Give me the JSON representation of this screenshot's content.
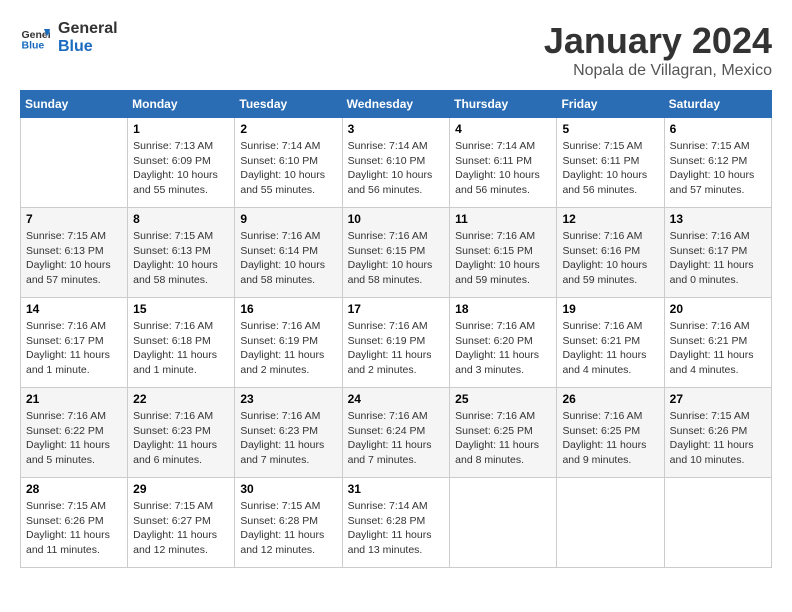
{
  "logo": {
    "line1": "General",
    "line2": "Blue"
  },
  "title": "January 2024",
  "subtitle": "Nopala de Villagran, Mexico",
  "headers": [
    "Sunday",
    "Monday",
    "Tuesday",
    "Wednesday",
    "Thursday",
    "Friday",
    "Saturday"
  ],
  "weeks": [
    [
      {
        "day": "",
        "info": ""
      },
      {
        "day": "1",
        "info": "Sunrise: 7:13 AM\nSunset: 6:09 PM\nDaylight: 10 hours\nand 55 minutes."
      },
      {
        "day": "2",
        "info": "Sunrise: 7:14 AM\nSunset: 6:10 PM\nDaylight: 10 hours\nand 55 minutes."
      },
      {
        "day": "3",
        "info": "Sunrise: 7:14 AM\nSunset: 6:10 PM\nDaylight: 10 hours\nand 56 minutes."
      },
      {
        "day": "4",
        "info": "Sunrise: 7:14 AM\nSunset: 6:11 PM\nDaylight: 10 hours\nand 56 minutes."
      },
      {
        "day": "5",
        "info": "Sunrise: 7:15 AM\nSunset: 6:11 PM\nDaylight: 10 hours\nand 56 minutes."
      },
      {
        "day": "6",
        "info": "Sunrise: 7:15 AM\nSunset: 6:12 PM\nDaylight: 10 hours\nand 57 minutes."
      }
    ],
    [
      {
        "day": "7",
        "info": "Sunrise: 7:15 AM\nSunset: 6:13 PM\nDaylight: 10 hours\nand 57 minutes."
      },
      {
        "day": "8",
        "info": "Sunrise: 7:15 AM\nSunset: 6:13 PM\nDaylight: 10 hours\nand 58 minutes."
      },
      {
        "day": "9",
        "info": "Sunrise: 7:16 AM\nSunset: 6:14 PM\nDaylight: 10 hours\nand 58 minutes."
      },
      {
        "day": "10",
        "info": "Sunrise: 7:16 AM\nSunset: 6:15 PM\nDaylight: 10 hours\nand 58 minutes."
      },
      {
        "day": "11",
        "info": "Sunrise: 7:16 AM\nSunset: 6:15 PM\nDaylight: 10 hours\nand 59 minutes."
      },
      {
        "day": "12",
        "info": "Sunrise: 7:16 AM\nSunset: 6:16 PM\nDaylight: 10 hours\nand 59 minutes."
      },
      {
        "day": "13",
        "info": "Sunrise: 7:16 AM\nSunset: 6:17 PM\nDaylight: 11 hours\nand 0 minutes."
      }
    ],
    [
      {
        "day": "14",
        "info": "Sunrise: 7:16 AM\nSunset: 6:17 PM\nDaylight: 11 hours\nand 1 minute."
      },
      {
        "day": "15",
        "info": "Sunrise: 7:16 AM\nSunset: 6:18 PM\nDaylight: 11 hours\nand 1 minute."
      },
      {
        "day": "16",
        "info": "Sunrise: 7:16 AM\nSunset: 6:19 PM\nDaylight: 11 hours\nand 2 minutes."
      },
      {
        "day": "17",
        "info": "Sunrise: 7:16 AM\nSunset: 6:19 PM\nDaylight: 11 hours\nand 2 minutes."
      },
      {
        "day": "18",
        "info": "Sunrise: 7:16 AM\nSunset: 6:20 PM\nDaylight: 11 hours\nand 3 minutes."
      },
      {
        "day": "19",
        "info": "Sunrise: 7:16 AM\nSunset: 6:21 PM\nDaylight: 11 hours\nand 4 minutes."
      },
      {
        "day": "20",
        "info": "Sunrise: 7:16 AM\nSunset: 6:21 PM\nDaylight: 11 hours\nand 4 minutes."
      }
    ],
    [
      {
        "day": "21",
        "info": "Sunrise: 7:16 AM\nSunset: 6:22 PM\nDaylight: 11 hours\nand 5 minutes."
      },
      {
        "day": "22",
        "info": "Sunrise: 7:16 AM\nSunset: 6:23 PM\nDaylight: 11 hours\nand 6 minutes."
      },
      {
        "day": "23",
        "info": "Sunrise: 7:16 AM\nSunset: 6:23 PM\nDaylight: 11 hours\nand 7 minutes."
      },
      {
        "day": "24",
        "info": "Sunrise: 7:16 AM\nSunset: 6:24 PM\nDaylight: 11 hours\nand 7 minutes."
      },
      {
        "day": "25",
        "info": "Sunrise: 7:16 AM\nSunset: 6:25 PM\nDaylight: 11 hours\nand 8 minutes."
      },
      {
        "day": "26",
        "info": "Sunrise: 7:16 AM\nSunset: 6:25 PM\nDaylight: 11 hours\nand 9 minutes."
      },
      {
        "day": "27",
        "info": "Sunrise: 7:15 AM\nSunset: 6:26 PM\nDaylight: 11 hours\nand 10 minutes."
      }
    ],
    [
      {
        "day": "28",
        "info": "Sunrise: 7:15 AM\nSunset: 6:26 PM\nDaylight: 11 hours\nand 11 minutes."
      },
      {
        "day": "29",
        "info": "Sunrise: 7:15 AM\nSunset: 6:27 PM\nDaylight: 11 hours\nand 12 minutes."
      },
      {
        "day": "30",
        "info": "Sunrise: 7:15 AM\nSunset: 6:28 PM\nDaylight: 11 hours\nand 12 minutes."
      },
      {
        "day": "31",
        "info": "Sunrise: 7:14 AM\nSunset: 6:28 PM\nDaylight: 11 hours\nand 13 minutes."
      },
      {
        "day": "",
        "info": ""
      },
      {
        "day": "",
        "info": ""
      },
      {
        "day": "",
        "info": ""
      }
    ]
  ]
}
